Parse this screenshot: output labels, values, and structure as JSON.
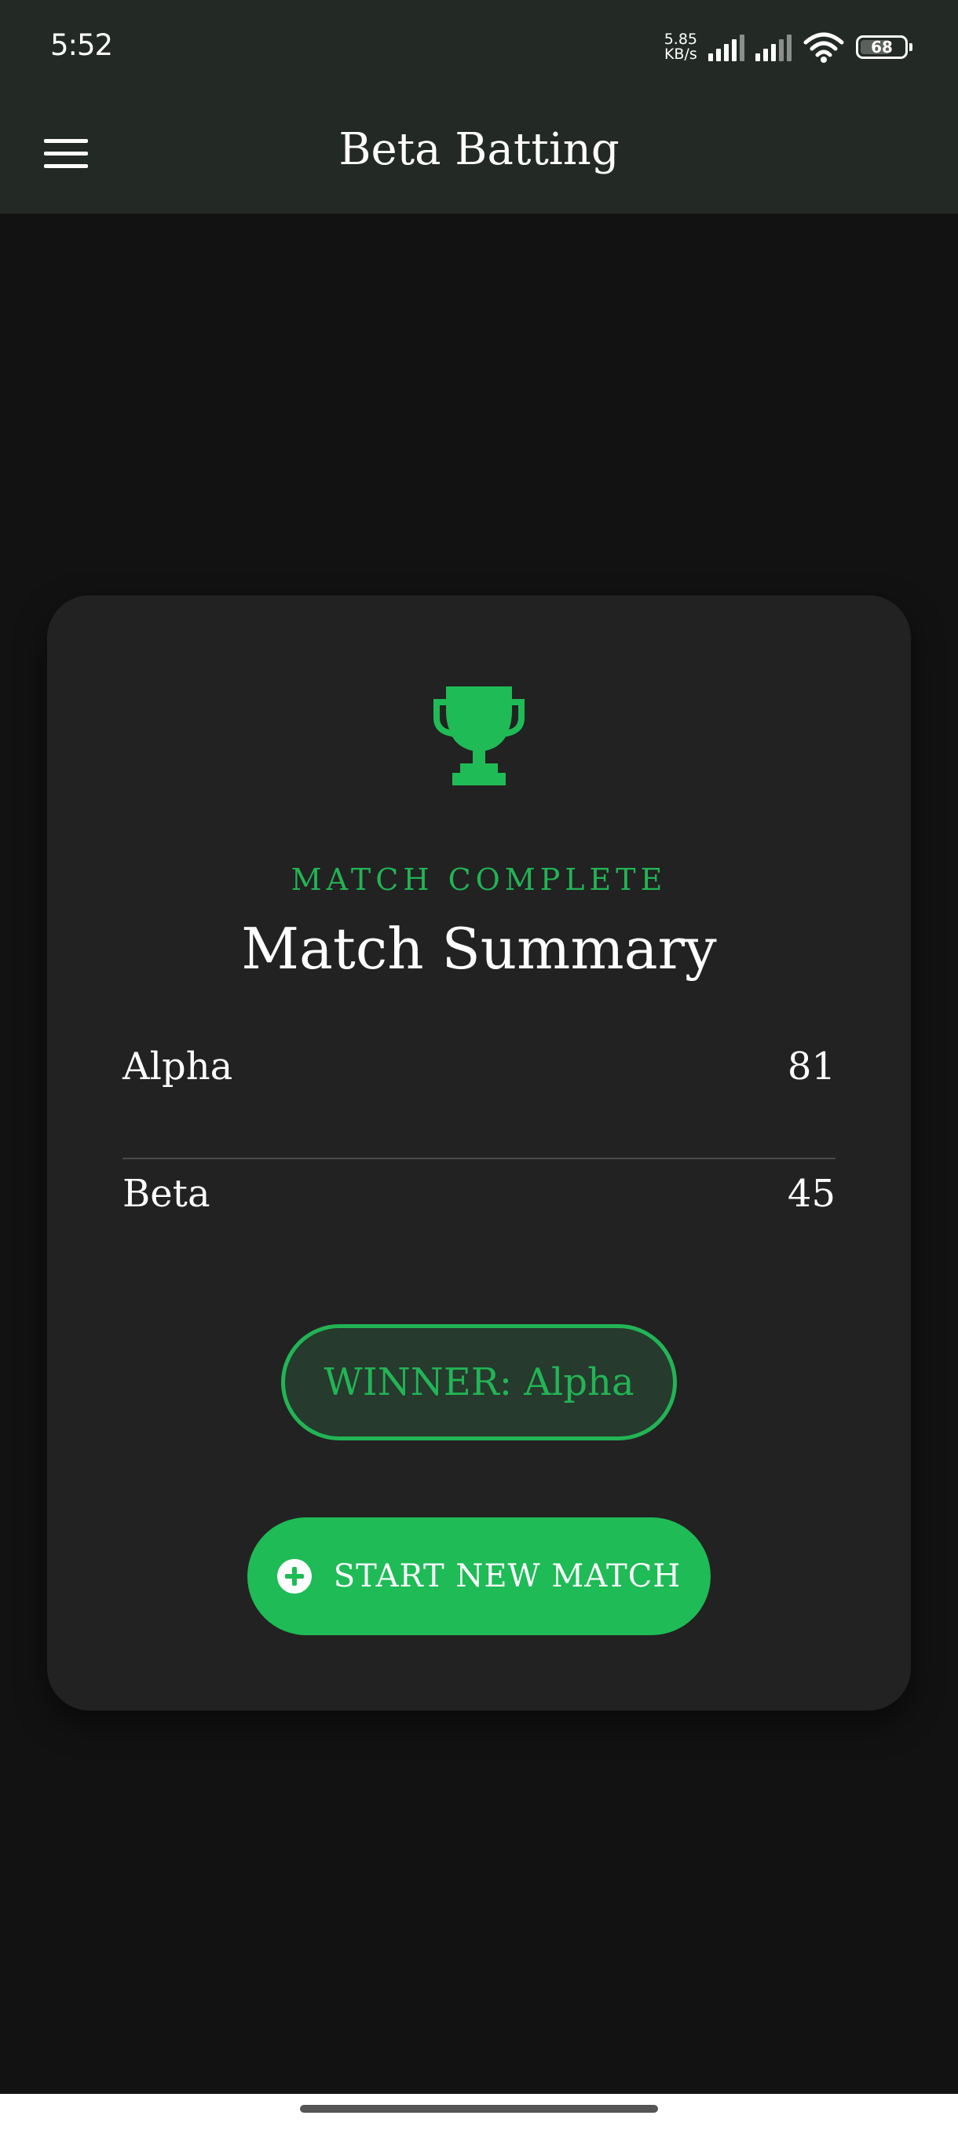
{
  "status_bar": {
    "time": "5:52",
    "net_speed_value": "5.85",
    "net_speed_unit": "KB/s",
    "battery_level": "68",
    "battery_fraction": 0.68,
    "icons": [
      "signal-icon",
      "signal-icon",
      "wifi-icon",
      "battery-icon"
    ]
  },
  "app_bar": {
    "title": "Beta Batting",
    "menu_icon": "hamburger-menu-icon"
  },
  "summary": {
    "icon": "trophy-icon",
    "subtitle": "MATCH COMPLETE",
    "title": "Match Summary",
    "teams": [
      {
        "name": "Alpha",
        "score": "81"
      },
      {
        "name": "Beta",
        "score": "45"
      }
    ],
    "winner": "WINNER: Alpha",
    "new_match_label": "START NEW MATCH",
    "new_match_icon": "plus-circle-icon"
  },
  "colors": {
    "accent": "#1fbb56",
    "accent_text": "#22b455",
    "background": "#121212",
    "card": "#222222",
    "app_bar": "#232a26"
  }
}
